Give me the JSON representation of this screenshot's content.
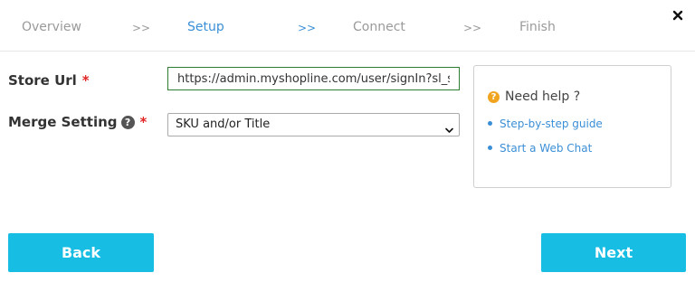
{
  "steps": [
    {
      "label": "Overview",
      "active": false
    },
    {
      "label": "Setup",
      "active": true
    },
    {
      "label": "Connect",
      "active": false
    },
    {
      "label": "Finish",
      "active": false
    }
  ],
  "separators": [
    ">>",
    ">>",
    ">>"
  ],
  "close_icon": "close-icon",
  "form": {
    "store_url_label": "Store Url",
    "store_url_required": "*",
    "store_url_value": "https://admin.myshopline.com/user/signIn?sl_s",
    "merge_label": "Merge Setting",
    "merge_info_icon": "?",
    "merge_required": "*",
    "merge_selected": "SKU and/or Title"
  },
  "help": {
    "icon": "?",
    "title": "Need help ?",
    "links": [
      "Step-by-step guide",
      "Start a Web Chat"
    ]
  },
  "buttons": {
    "back": "Back",
    "next": "Next"
  },
  "colors": {
    "accent": "#17bde3",
    "active_step": "#3b8fd6",
    "required": "#e02424",
    "help_icon": "#f0a420"
  }
}
